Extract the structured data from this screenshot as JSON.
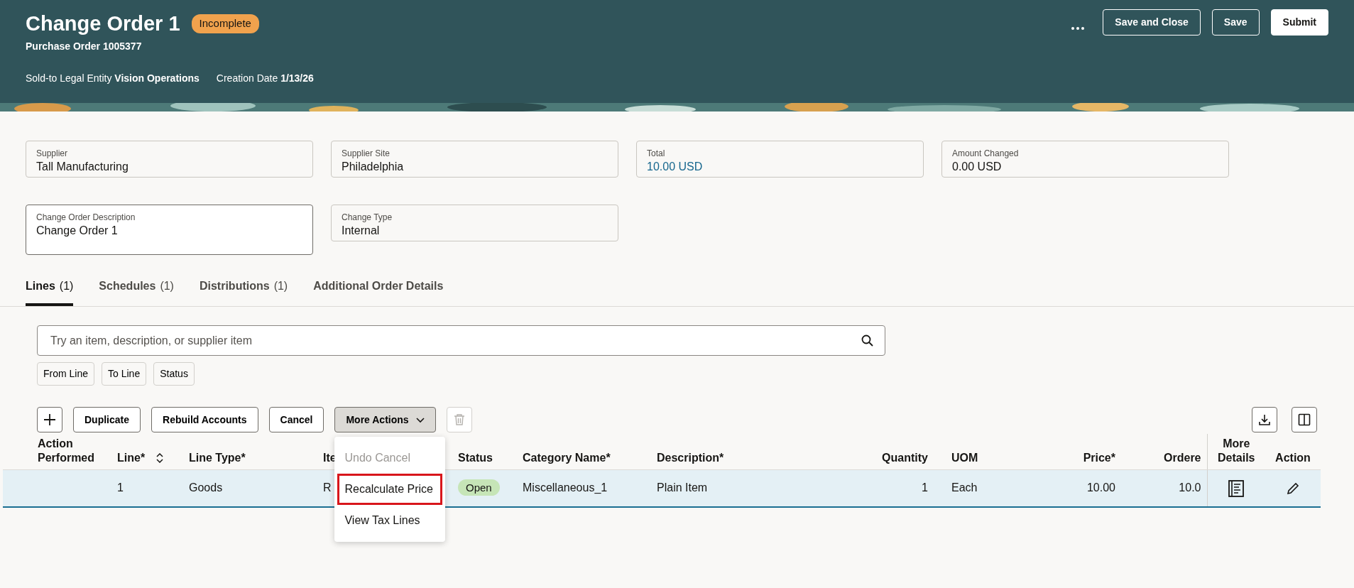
{
  "header": {
    "title": "Change Order 1",
    "status": "Incomplete",
    "subtitle": "Purchase Order 1005377",
    "meta": [
      {
        "label": "Sold-to Legal Entity",
        "value": "Vision Operations"
      },
      {
        "label": "Creation Date",
        "value": "1/13/26"
      }
    ],
    "buttons": [
      {
        "label": "Save and Close",
        "kind": "outline"
      },
      {
        "label": "Save",
        "kind": "outline"
      },
      {
        "label": "Submit",
        "kind": "primary"
      }
    ]
  },
  "fields": [
    {
      "label": "Supplier",
      "value": "Tall Manufacturing",
      "kind": "readonly"
    },
    {
      "label": "Supplier Site",
      "value": "Philadelphia",
      "kind": "readonly"
    },
    {
      "label": "Total",
      "value": "10.00 USD",
      "kind": "link"
    },
    {
      "label": "Amount Changed",
      "value": "0.00 USD",
      "kind": "readonly"
    },
    {
      "label": "Change Order Description",
      "value": "Change Order 1",
      "kind": "editable"
    },
    {
      "label": "Change Type",
      "value": "Internal",
      "kind": "readonly"
    }
  ],
  "tabs": [
    {
      "label": "Lines",
      "count": "(1)",
      "selected": true
    },
    {
      "label": "Schedules",
      "count": "(1)",
      "selected": false
    },
    {
      "label": "Distributions",
      "count": "(1)",
      "selected": false
    },
    {
      "label": "Additional Order Details",
      "selected": false
    }
  ],
  "search": {
    "placeholder": "Try an item, description, or supplier item"
  },
  "filters": [
    "From Line",
    "To Line",
    "Status"
  ],
  "toolbar": [
    {
      "kind": "add"
    },
    {
      "kind": "text",
      "label": "Duplicate"
    },
    {
      "kind": "text",
      "label": "Rebuild Accounts"
    },
    {
      "kind": "text",
      "label": "Cancel"
    },
    {
      "kind": "menu",
      "label": "More Actions",
      "expanded": true
    },
    {
      "kind": "delete",
      "disabled": true
    }
  ],
  "menu": [
    {
      "label": "Undo Cancel",
      "disabled": true,
      "highlighted": false
    },
    {
      "label": "Recalculate Price",
      "disabled": false,
      "highlighted": true
    },
    {
      "label": "View Tax Lines",
      "disabled": false,
      "highlighted": false
    }
  ],
  "table": {
    "columns": [
      {
        "label": "Action Performed"
      },
      {
        "label": "Line*",
        "sortable": true
      },
      {
        "label": "Line Type*"
      },
      {
        "label": "Ite"
      },
      {
        "label": "Status"
      },
      {
        "label": "Category Name*"
      },
      {
        "label": "Description*"
      },
      {
        "label": "Quantity"
      },
      {
        "label": "UOM"
      },
      {
        "label": "Price*"
      },
      {
        "label": "Ordere"
      },
      {
        "label": "More Details"
      },
      {
        "label": "Action"
      }
    ],
    "rows": [
      {
        "selected": true,
        "cells": [
          null,
          "1",
          "Goods",
          "R",
          "Open",
          "Miscellaneous_1",
          "Plain Item",
          "1",
          "Each",
          "10.00",
          "10.0"
        ]
      }
    ]
  }
}
